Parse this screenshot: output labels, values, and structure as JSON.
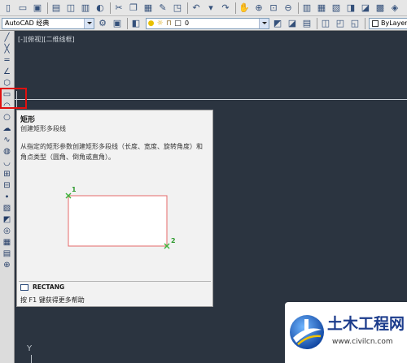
{
  "toolbar_standard": {
    "icons": [
      {
        "name": "new-file-icon",
        "glyph": "▯"
      },
      {
        "name": "open-file-icon",
        "glyph": "▭"
      },
      {
        "name": "save-icon",
        "glyph": "▣"
      },
      {
        "name": "plot-icon",
        "glyph": "▤"
      },
      {
        "name": "plot-preview-icon",
        "glyph": "◫"
      },
      {
        "name": "publish-icon",
        "glyph": "▥"
      },
      {
        "name": "3d-dwf-icon",
        "glyph": "◐"
      },
      {
        "name": "cut-icon",
        "glyph": "✂"
      },
      {
        "name": "copy-icon",
        "glyph": "❐"
      },
      {
        "name": "paste-icon",
        "glyph": "▦"
      },
      {
        "name": "match-properties-icon",
        "glyph": "✎"
      },
      {
        "name": "block-editor-icon",
        "glyph": "◳"
      },
      {
        "name": "undo-icon",
        "glyph": "↶"
      },
      {
        "name": "undo-dropdown-icon",
        "glyph": "▾"
      },
      {
        "name": "redo-icon",
        "glyph": "↷"
      },
      {
        "name": "pan-realtime-icon",
        "glyph": "✋"
      },
      {
        "name": "zoom-realtime-icon",
        "glyph": "⊕"
      },
      {
        "name": "zoom-window-icon",
        "glyph": "⊡"
      },
      {
        "name": "zoom-previous-icon",
        "glyph": "⊖"
      },
      {
        "name": "properties-icon",
        "glyph": "▥"
      },
      {
        "name": "design-center-icon",
        "glyph": "▦"
      },
      {
        "name": "tool-palettes-icon",
        "glyph": "▧"
      },
      {
        "name": "sheet-set-manager-icon",
        "glyph": "◨"
      },
      {
        "name": "markup-set-manager-icon",
        "glyph": "◪"
      },
      {
        "name": "quickcalc-icon",
        "glyph": "▩"
      },
      {
        "name": "help-icon",
        "glyph": "◈"
      }
    ]
  },
  "toolbar_workspaces": {
    "current": "AutoCAD 经典",
    "icons": [
      {
        "name": "workspace-settings-gear-icon",
        "glyph": "⚙"
      },
      {
        "name": "my-workspace-icon",
        "glyph": "▣"
      }
    ]
  },
  "toolbar_layers": {
    "current_layer": "0",
    "left_icons": [
      {
        "name": "layer-properties-icon",
        "glyph": "◧"
      }
    ],
    "state_icons": [
      {
        "name": "layer-on-bulb-icon",
        "glyph": "●",
        "color": "#e8c000"
      },
      {
        "name": "layer-thaw-sun-icon",
        "glyph": "☼",
        "color": "#d9a400"
      },
      {
        "name": "layer-unlock-icon",
        "glyph": "⊓",
        "color": "#8a6a2a"
      },
      {
        "name": "layer-color-swatch-icon",
        "glyph": "□",
        "color": "#222222"
      }
    ],
    "right_icons": [
      {
        "name": "make-object-layer-current-icon",
        "glyph": "◩"
      },
      {
        "name": "layer-previous-icon",
        "glyph": "◪"
      },
      {
        "name": "layer-states-icon",
        "glyph": "▤"
      }
    ],
    "more_icons": [
      {
        "name": "layer-isolate-icon",
        "glyph": "◫"
      },
      {
        "name": "layer-walk-icon",
        "glyph": "◰"
      },
      {
        "name": "layer-freeze-icon",
        "glyph": "◱"
      }
    ]
  },
  "toolbar_properties": {
    "color": "ByLayer"
  },
  "draw_toolbar": {
    "icons": [
      {
        "name": "line-icon",
        "glyph": "╱"
      },
      {
        "name": "construction-line-icon",
        "glyph": "╳"
      },
      {
        "name": "multiline-icon",
        "glyph": "═"
      },
      {
        "name": "polyline-icon",
        "glyph": "∠"
      },
      {
        "name": "polygon-icon",
        "glyph": "⬡"
      },
      {
        "name": "rectangle-icon",
        "glyph": "▭"
      },
      {
        "name": "arc-icon",
        "glyph": "◠"
      },
      {
        "name": "circle-icon",
        "glyph": "○"
      },
      {
        "name": "revision-cloud-icon",
        "glyph": "☁"
      },
      {
        "name": "spline-icon",
        "glyph": "∿"
      },
      {
        "name": "ellipse-icon",
        "glyph": "◍"
      },
      {
        "name": "ellipse-arc-icon",
        "glyph": "◡"
      },
      {
        "name": "insert-block-icon",
        "glyph": "⊞"
      },
      {
        "name": "make-block-icon",
        "glyph": "⊟"
      },
      {
        "name": "point-icon",
        "glyph": "∙"
      },
      {
        "name": "hatch-icon",
        "glyph": "▨"
      },
      {
        "name": "gradient-icon",
        "glyph": "◩"
      },
      {
        "name": "region-icon",
        "glyph": "◎"
      },
      {
        "name": "table-icon",
        "glyph": "▦"
      },
      {
        "name": "multiline-text-icon",
        "glyph": "▤"
      },
      {
        "name": "add-selected-icon",
        "glyph": "⊕"
      }
    ]
  },
  "viewport": {
    "label": "[-][俯视][二维线框]"
  },
  "tooltip": {
    "title": "矩形",
    "subtitle": "创建矩形多段线",
    "description_lines": [
      "从指定的矩形参数创建矩形多段线（长度、宽度、旋转角度）和",
      "角点类型（圆角、倒角或直角）。"
    ],
    "point_1": "1",
    "point_2": "2",
    "command": "RECTANG",
    "help": "按 F1 键获得更多帮助"
  },
  "ucs": {
    "y_label": "Y"
  },
  "watermark": {
    "name": "土木工程网",
    "url": "www.civilcn.com"
  },
  "colors": {
    "canvas": "#2b3440",
    "highlight": "#e01010",
    "rect_stroke": "#e46a6a",
    "point_marker": "#3cb43c",
    "watermark_text": "#1c3c8c"
  }
}
